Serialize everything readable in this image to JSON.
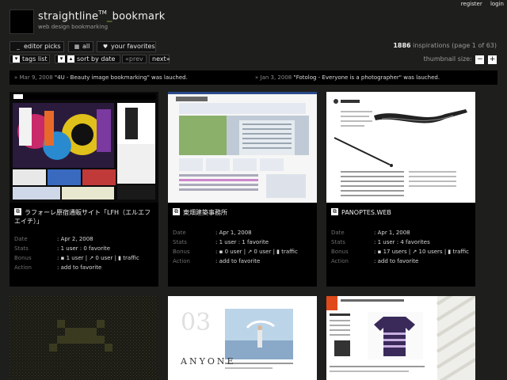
{
  "top_links": {
    "register": "register",
    "login": "login"
  },
  "site": {
    "title_main": "straightline",
    "title_tm": "TM",
    "title_sep": "_",
    "title_end": "bookmark",
    "subtitle": "web design bookmarking"
  },
  "nav": {
    "editor_picks": "editor picks",
    "all": "all",
    "favorites": "your favorites",
    "tags_list": "tags list",
    "sort_by_date": "sort by date",
    "prev": "«prev",
    "next": "next»"
  },
  "inspirations": {
    "count": "1886",
    "text": "inspirations (page 1 of 63)"
  },
  "thumb_size": {
    "label": "thumbnail size:",
    "minus": "−",
    "plus": "+"
  },
  "news": [
    {
      "date": "» Mar 9, 2008",
      "text": "\"4U - Beauty image bookmarking\" was lauched."
    },
    {
      "date": "» Jan 3, 2008",
      "text": "\"Fotolog - Everyone is a photographer\" was lauched."
    }
  ],
  "meta_labels": {
    "date": "Date",
    "stats": "Stats",
    "bonus": "Bonus",
    "action": "Action"
  },
  "cards": [
    {
      "name": "ラフォーレ原宿通販サイト「LFH（エルエフエイチ）」",
      "date": ": Apr 2, 2008",
      "stats": ": 1 user : 0 favorite",
      "bonus_users": "1 user",
      "bonus_zero": "0 user",
      "bonus_traffic": "traffic",
      "action": ": add to favorite"
    },
    {
      "name": "東畑建築事務所",
      "date": ": Apr 1, 2008",
      "stats": ": 1 user : 1 favorite",
      "bonus_users": "0 user",
      "bonus_zero": "0 user",
      "bonus_traffic": "traffic",
      "action": ": add to favorite"
    },
    {
      "name": "PANOPTES.WEB",
      "date": ": Apr 1, 2008",
      "stats": ": 1 user : 4 favorites",
      "bonus_users": "17 users",
      "bonus_zero": "10 users",
      "bonus_traffic": "traffic",
      "action": ": add to favorite"
    }
  ],
  "bottom_cards": {
    "anyone": "ANYONE",
    "anyone_num": "03"
  },
  "colors": {
    "accent": "#7da338",
    "bg": "#1e1f1c",
    "card": "#000000"
  }
}
